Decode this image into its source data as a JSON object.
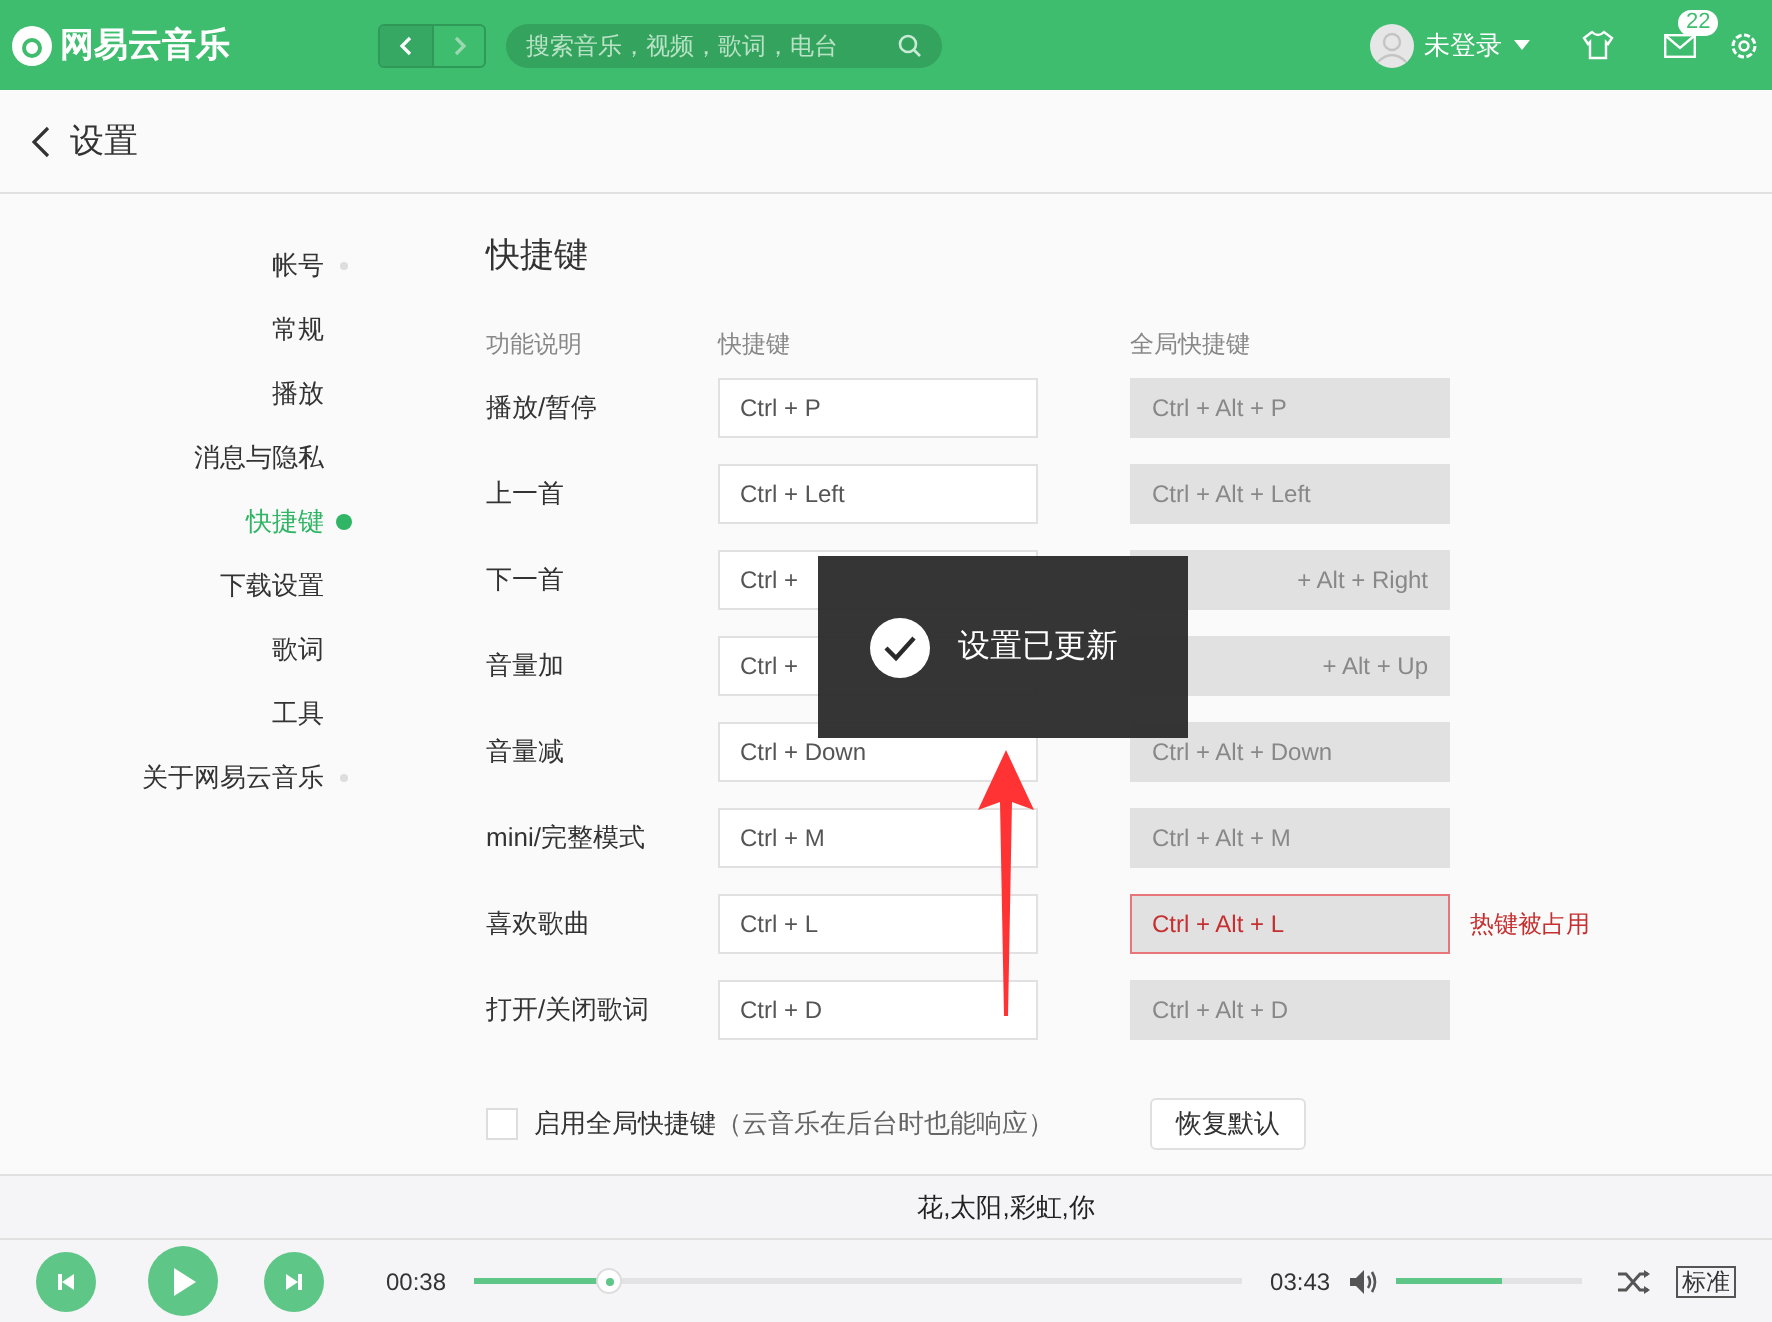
{
  "top_bar": {
    "app_name": "网易云音乐",
    "search": {
      "placeholder": "搜索音乐，视频，歌词，电台"
    },
    "user": "未登录",
    "message_count": "22"
  },
  "header": {
    "title": "设置"
  },
  "sidebar": {
    "items": [
      {
        "label": "帐号",
        "selected": false
      },
      {
        "label": "常规",
        "selected": false
      },
      {
        "label": "播放",
        "selected": false
      },
      {
        "label": "消息与隐私",
        "selected": false
      },
      {
        "label": "快捷键",
        "selected": true
      },
      {
        "label": "下载设置",
        "selected": false
      },
      {
        "label": "歌词",
        "selected": false
      },
      {
        "label": "工具",
        "selected": false
      },
      {
        "label": "关于网易云音乐",
        "selected": false
      }
    ]
  },
  "shortcuts": {
    "title": "快捷键",
    "columns": [
      "功能说明",
      "快捷键",
      "全局快捷键"
    ],
    "rows": [
      {
        "action": "播放/暂停",
        "hotkey": "Ctrl + P",
        "global": "Ctrl + Alt + P",
        "conflict": false
      },
      {
        "action": "上一首",
        "hotkey": "Ctrl + Left",
        "global": "Ctrl + Alt + Left",
        "conflict": false
      },
      {
        "action": "下一首",
        "hotkey": "Ctrl +",
        "global": "+ Alt + Right",
        "conflict": false
      },
      {
        "action": "音量加",
        "hotkey": "Ctrl +",
        "global": "+ Alt + Up",
        "conflict": false
      },
      {
        "action": "音量减",
        "hotkey": "Ctrl + Down",
        "global": "Ctrl + Alt + Down",
        "conflict": false
      },
      {
        "action": "mini/完整模式",
        "hotkey": "Ctrl + M",
        "global": "Ctrl + Alt + M",
        "conflict": false
      },
      {
        "action": "喜欢歌曲",
        "hotkey": "Ctrl + L",
        "global": "Ctrl + Alt + L",
        "conflict": true,
        "warning": "热键被占用"
      },
      {
        "action": "打开/关闭歌词",
        "hotkey": "Ctrl + D",
        "global": "Ctrl + Alt + D",
        "conflict": false
      }
    ],
    "enable_global": {
      "label": "启用全局快捷键",
      "hint": "（云音乐在后台时也能响应）",
      "checked": false
    },
    "reset_button": "恢复默认"
  },
  "toast": {
    "message": "设置已更新"
  },
  "lyric": "花,太阳,彩虹,你",
  "player": {
    "elapsed": "00:38",
    "progress": {
      "level": 0.175
    },
    "duration": "03:43",
    "volume": {
      "level": 0.57
    },
    "quality": "标准"
  }
}
